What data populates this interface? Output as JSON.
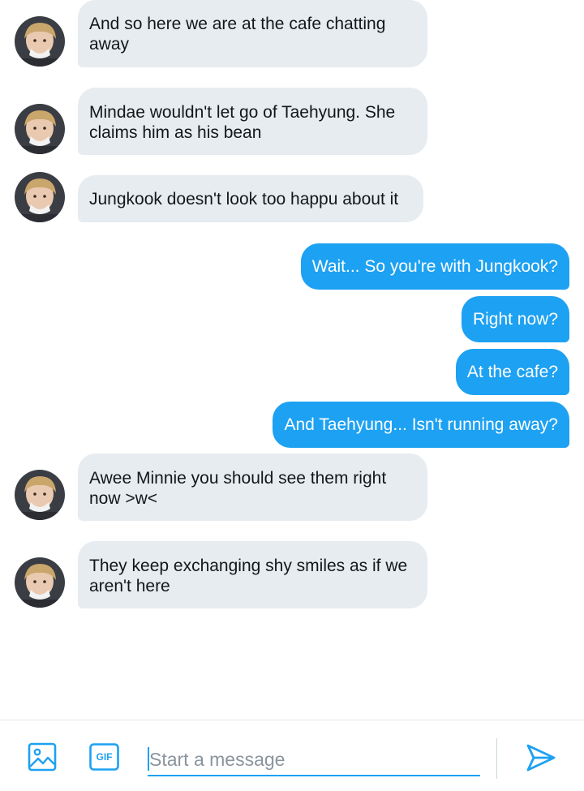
{
  "colors": {
    "incoming_bubble": "#e6ecf0",
    "outgoing_bubble": "#1da1f2",
    "accent": "#1da1f2"
  },
  "messages": [
    {
      "direction": "in",
      "text_lines": [
        "And so here we are at the cafe chatting",
        "away"
      ]
    },
    {
      "direction": "in",
      "text_lines": [
        "Mindae wouldn't let go of Taehyung. She",
        "claims him as his bean"
      ]
    },
    {
      "direction": "in",
      "text_lines": [
        "Jungkook doesn't look too happu about it"
      ]
    },
    {
      "direction": "out",
      "text_lines": [
        "Wait... So you're with Jungkook?"
      ]
    },
    {
      "direction": "out",
      "text_lines": [
        "Right now?"
      ]
    },
    {
      "direction": "out",
      "text_lines": [
        "At the cafe?"
      ]
    },
    {
      "direction": "out",
      "text_lines": [
        "And Taehyung... Isn't running away?"
      ]
    },
    {
      "direction": "in",
      "text_lines": [
        "Awee Minnie you should see them right",
        "now >w<"
      ]
    },
    {
      "direction": "in",
      "text_lines": [
        "They keep exchanging shy smiles as if we",
        "aren't here"
      ]
    }
  ],
  "composer": {
    "placeholder": "Start a message",
    "value": "",
    "media_icon": "image-icon",
    "gif_label": "GIF",
    "send_icon": "send-icon"
  }
}
